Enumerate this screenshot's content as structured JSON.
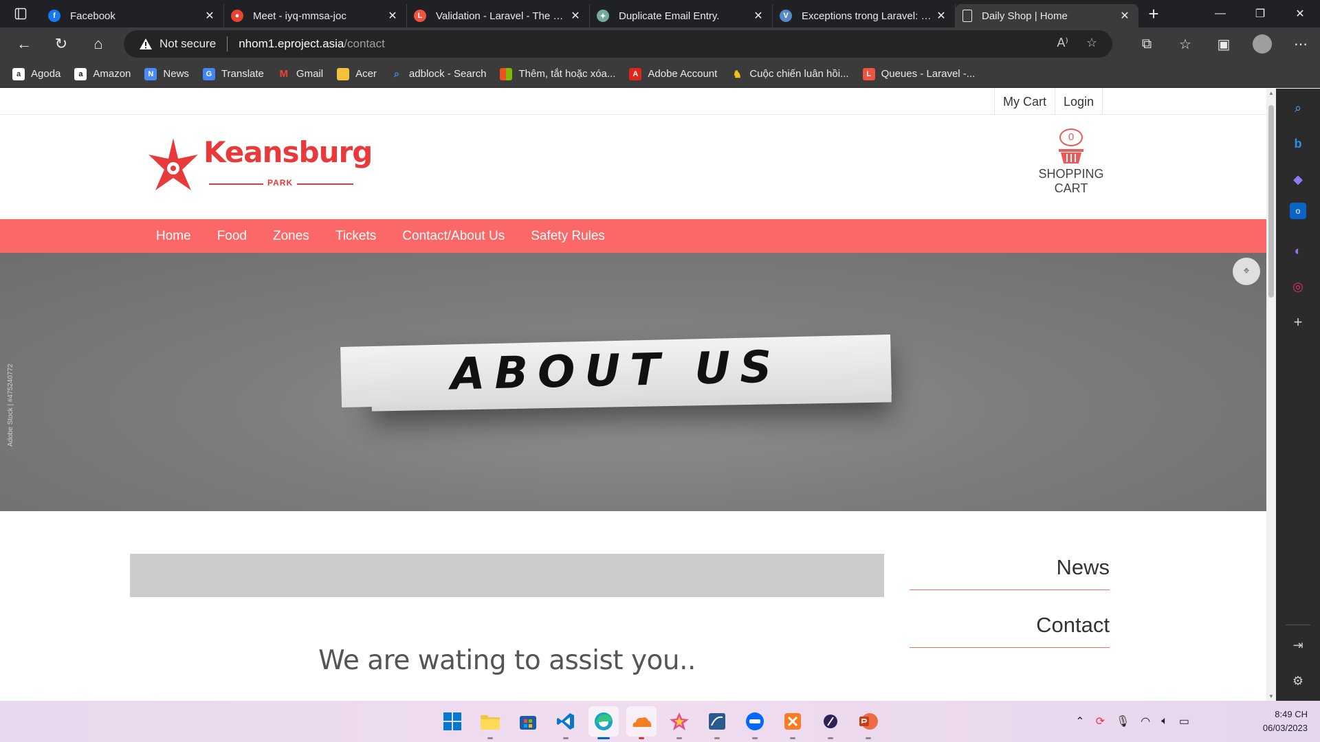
{
  "browser": {
    "tabs": [
      {
        "title": "Facebook",
        "favicon": "facebook-icon",
        "color": "#1877f2"
      },
      {
        "title": "Meet - iyq-mmsa-joc",
        "favicon": "meet-icon",
        "color": "#ea4335"
      },
      {
        "title": "Validation - Laravel - The PHP",
        "favicon": "laravel-icon",
        "color": "#f05340"
      },
      {
        "title": "Duplicate Email Entry.",
        "favicon": "chatgpt-icon",
        "color": "#74aa9c"
      },
      {
        "title": "Exceptions trong Laravel: Làm",
        "favicon": "viblo-icon",
        "color": "#5488c7"
      },
      {
        "title": "Daily Shop | Home",
        "favicon": "page-icon",
        "color": "#5f6368"
      }
    ],
    "address": {
      "security": "Not secure",
      "host": "nhom1.eproject.asia",
      "path": "/contact"
    },
    "bookmarks": [
      {
        "label": "Agoda",
        "icon": "agoda-icon",
        "color": "#ffffff"
      },
      {
        "label": "Amazon",
        "icon": "amazon-icon",
        "color": "#ffffff"
      },
      {
        "label": "News",
        "icon": "news-icon",
        "color": "#4a8cf7"
      },
      {
        "label": "Translate",
        "icon": "translate-icon",
        "color": "#4285f4"
      },
      {
        "label": "Gmail",
        "icon": "gmail-icon",
        "color": "#ea4335"
      },
      {
        "label": "Acer",
        "icon": "folder-icon",
        "color": "#f3c13a"
      },
      {
        "label": "adblock - Search",
        "icon": "search-icon",
        "color": "#4a8cf7"
      },
      {
        "label": "Thêm, tắt hoặc xóa...",
        "icon": "microsoft-icon",
        "color": "#f25022"
      },
      {
        "label": "Adobe Account",
        "icon": "adobe-icon",
        "color": "#e1251b"
      },
      {
        "label": "Cuộc chiến luân hồi...",
        "icon": "game-icon",
        "color": "#f2c21b"
      },
      {
        "label": "Queues - Laravel -...",
        "icon": "laravel-icon",
        "color": "#f05340"
      }
    ]
  },
  "site": {
    "topbar": {
      "my_cart": "My Cart",
      "login": "Login"
    },
    "logo": {
      "name": "Keansburg",
      "sub": "PARK",
      "color": "#e8393b"
    },
    "cart": {
      "count": "0",
      "label": "SHOPPING CART"
    },
    "nav": [
      "Home",
      "Food",
      "Zones",
      "Tickets",
      "Contact/About Us",
      "Safety Rules"
    ],
    "accent": "#fc6868",
    "hero": {
      "text": "ABOUT US",
      "credit": "Adobe Stock | #475240772"
    },
    "content": {
      "heading": "We are wating to assist you..",
      "side_links": [
        "News",
        "Contact"
      ]
    }
  },
  "taskbar": {
    "apps": [
      {
        "name": "start-icon",
        "color": "#0067c0"
      },
      {
        "name": "file-explorer-icon",
        "color": "#f4c542"
      },
      {
        "name": "store-icon",
        "color": "#1c5ba8"
      },
      {
        "name": "vscode-icon",
        "color": "#0a76c8"
      },
      {
        "name": "edge-icon",
        "color": "#1aa3c9"
      },
      {
        "name": "cloudflare-icon",
        "color": "#f38020"
      },
      {
        "name": "star-app-icon",
        "color": "#e94a8a"
      },
      {
        "name": "sql-workbench-icon",
        "color": "#2a5a8c"
      },
      {
        "name": "zalo-icon",
        "color": "#0068ff"
      },
      {
        "name": "xampp-icon",
        "color": "#fb7a24"
      },
      {
        "name": "eclipse-icon",
        "color": "#2c2255"
      },
      {
        "name": "powerpoint-icon",
        "color": "#d24726"
      }
    ],
    "time": "8:49 CH",
    "date": "06/03/2023"
  }
}
